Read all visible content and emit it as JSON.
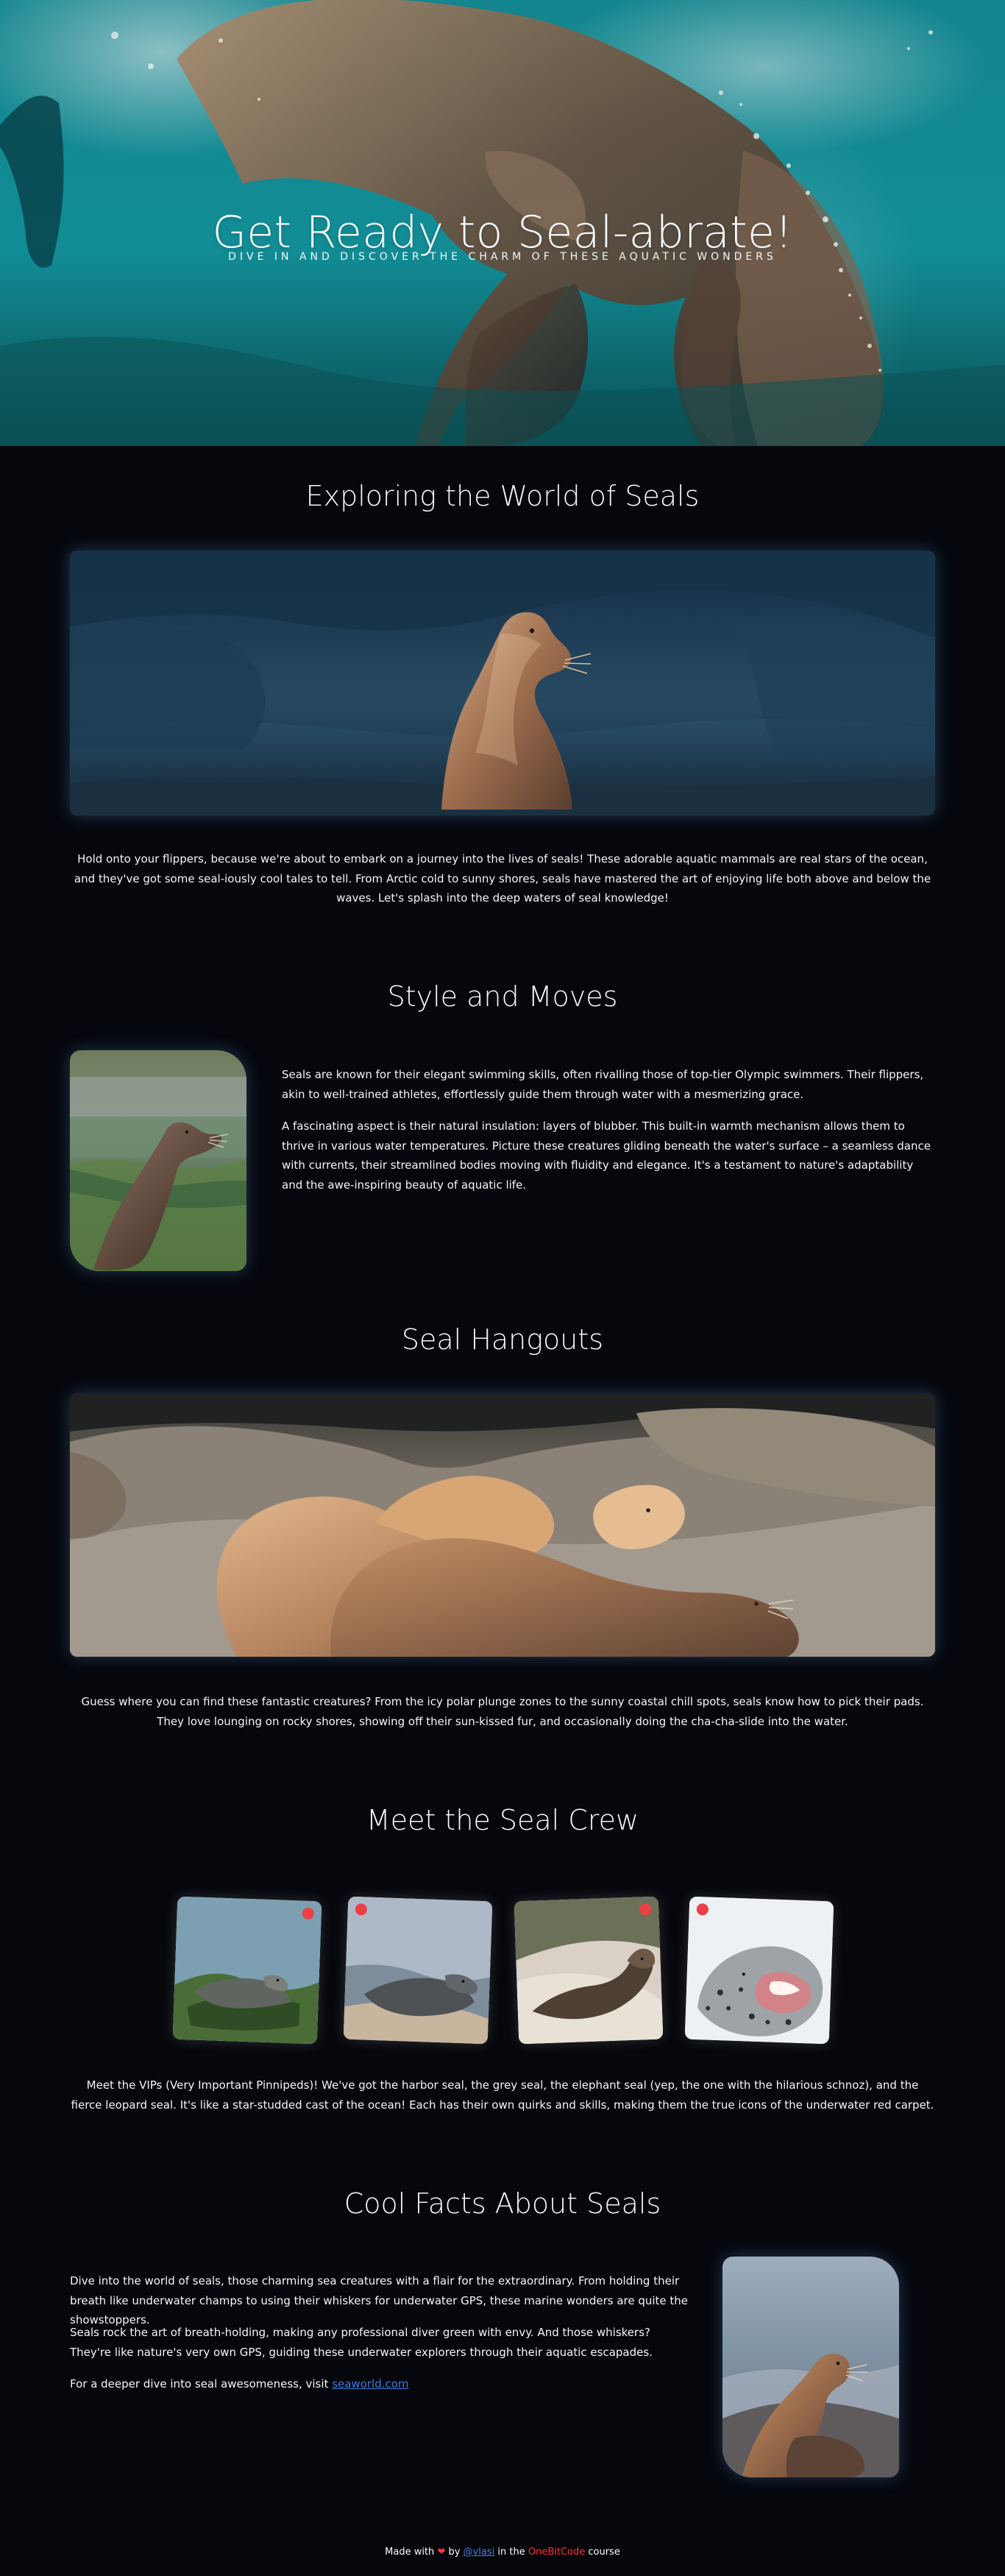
{
  "hero": {
    "title": "Get Ready to Seal-abrate!",
    "subtitle": "DIVE IN AND DISCOVER THE CHARM OF THESE AQUATIC WONDERS"
  },
  "sections": {
    "exploring": {
      "title": "Exploring the World of Seals",
      "body": "Hold onto your flippers, because we're about to embark on a journey into the lives of seals! These adorable aquatic mammals are real stars of the ocean, and they've got some seal-iously cool tales to tell. From Arctic cold to sunny shores, seals have mastered the art of enjoying life both above and below the waves. Let's splash into the deep waters of seal knowledge!"
    },
    "style": {
      "title": "Style and Moves",
      "paragraph1": "Seals are known for their elegant swimming skills, often rivalling those of top-tier Olympic swimmers. Their flippers, akin to well-trained athletes, effortlessly guide them through water with a mesmerizing grace.",
      "paragraph2": "A fascinating aspect is their natural insulation: layers of blubber. This built-in warmth mechanism allows them to thrive in various water temperatures. Picture these creatures gliding beneath the water's surface – a seamless dance with currents, their streamlined bodies moving with fluidity and elegance. It's a testament to nature's adaptability and the awe-inspiring beauty of aquatic life."
    },
    "hangouts": {
      "title": "Seal Hangouts",
      "body": "Guess where you can find these fantastic creatures? From the icy polar plunge zones to the sunny coastal chill spots, seals know how to pick their pads. They love lounging on rocky shores, showing off their sun-kissed fur, and occasionally doing the cha-cha-slide into the water."
    },
    "crew": {
      "title": "Meet the Seal Crew",
      "body": "Meet the VIPs (Very Important Pinnipeds)! We've got the harbor seal, the grey seal, the elephant seal (yep, the one with the hilarious schnoz), and the fierce leopard seal. It's like a star-studded cast of the ocean! Each has their own quirks and skills, making them the true icons of the underwater red carpet."
    },
    "facts": {
      "title": "Cool Facts About Seals",
      "paragraph1": "Dive into the world of seals, those charming sea creatures with a flair for the extraordinary. From holding their breath like underwater champs to using their whiskers for underwater GPS, these marine wonders are quite the showstoppers.",
      "paragraph2": "Seals rock the art of breath-holding, making any professional diver green with envy. And those whiskers? They're like nature's very own GPS, guiding these underwater explorers through their aquatic escapades.",
      "paragraph3_prefix": "For a deeper dive into seal awesomeness, visit",
      "link_text": "seaworld.com"
    }
  },
  "footer": {
    "prefix": "Made with",
    "heart": "❤",
    "by": "by",
    "handle": "@vlasi",
    "middle": "in the",
    "brand": "OneBitCode",
    "suffix": "course"
  }
}
